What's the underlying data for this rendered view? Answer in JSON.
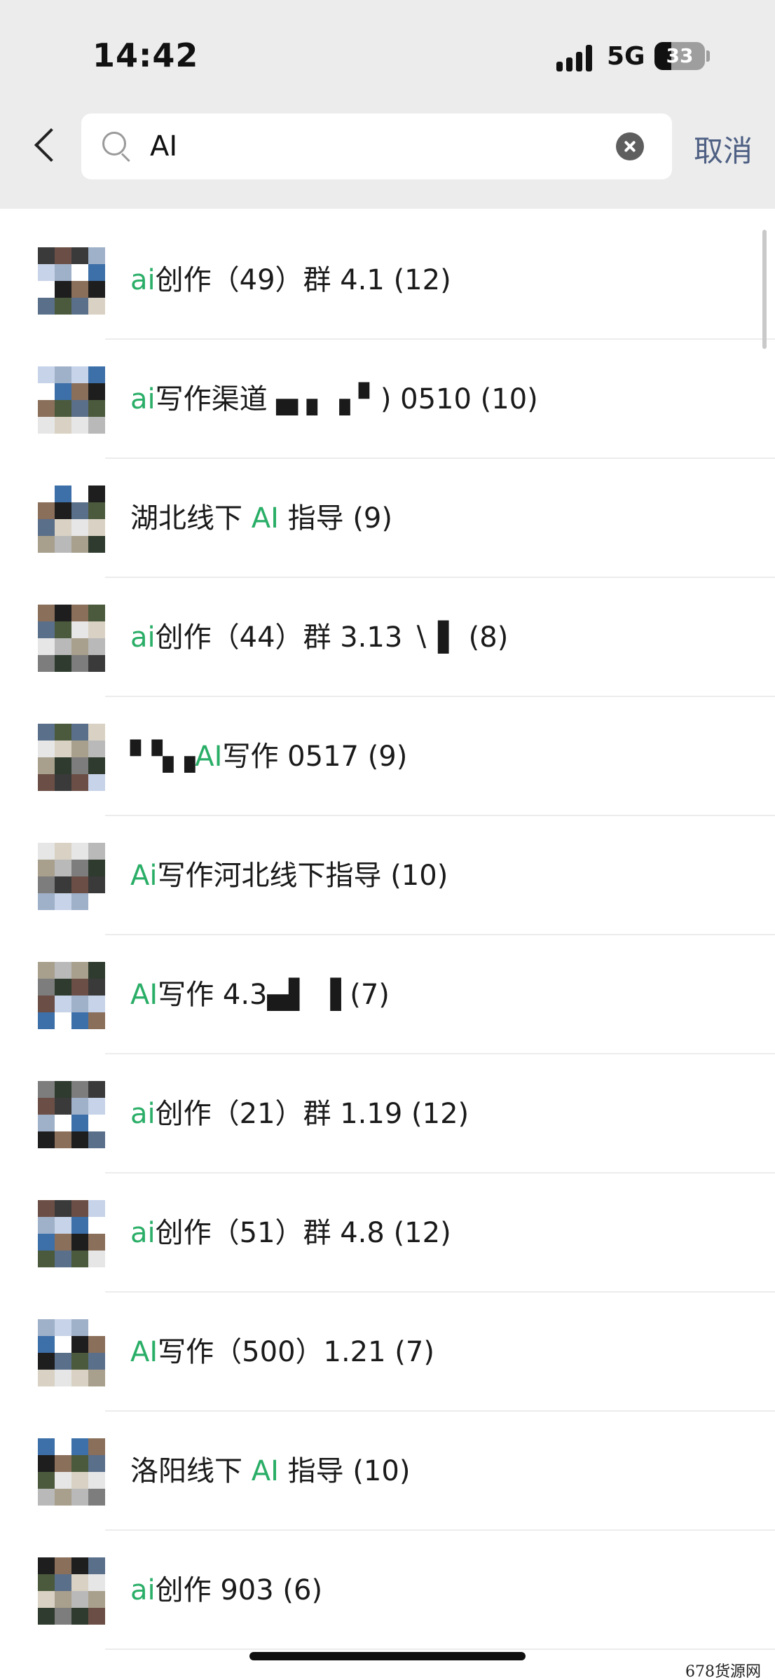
{
  "status_bar": {
    "time": "14:42",
    "network": "5G",
    "battery": "33",
    "battery_level": 0.33
  },
  "search": {
    "query": "AI",
    "placeholder": "",
    "cancel_label": "取消"
  },
  "results": [
    {
      "prefix": "",
      "highlight": "ai",
      "rest": "创作（49）群 4.1 (12)"
    },
    {
      "prefix": "",
      "highlight": "ai",
      "rest": "写作渠道 ▄ ▖▗ ▘) 0510 (10)"
    },
    {
      "prefix": "湖北线下 ",
      "highlight": "AI",
      "rest": " 指导 (9)"
    },
    {
      "prefix": "",
      "highlight": "ai",
      "rest": "创作（44）群 3.13 ∖ ▌   (8)"
    },
    {
      "prefix": "▘▚▗",
      "highlight": "AI",
      "rest": "写作 0517 (9)"
    },
    {
      "prefix": "",
      "highlight": "Ai",
      "rest": "写作河北线下指导 (10)"
    },
    {
      "prefix": "",
      "highlight": "AI",
      "rest": "写作 4.3▄▌ ▐ (7)"
    },
    {
      "prefix": "",
      "highlight": "ai",
      "rest": "创作（21）群 1.19 (12)"
    },
    {
      "prefix": "",
      "highlight": "ai",
      "rest": "创作（51）群 4.8 (12)"
    },
    {
      "prefix": "",
      "highlight": "AI",
      "rest": "写作（500）1.21 (7)"
    },
    {
      "prefix": "洛阳线下 ",
      "highlight": "AI",
      "rest": " 指导 (10)"
    },
    {
      "prefix": "",
      "highlight": "ai",
      "rest": "创作 903 (6)"
    }
  ],
  "watermark": "678货源网",
  "colors": {
    "highlight": "#2aae67",
    "cancel": "#4d5f83",
    "header_bg": "#ececec"
  }
}
